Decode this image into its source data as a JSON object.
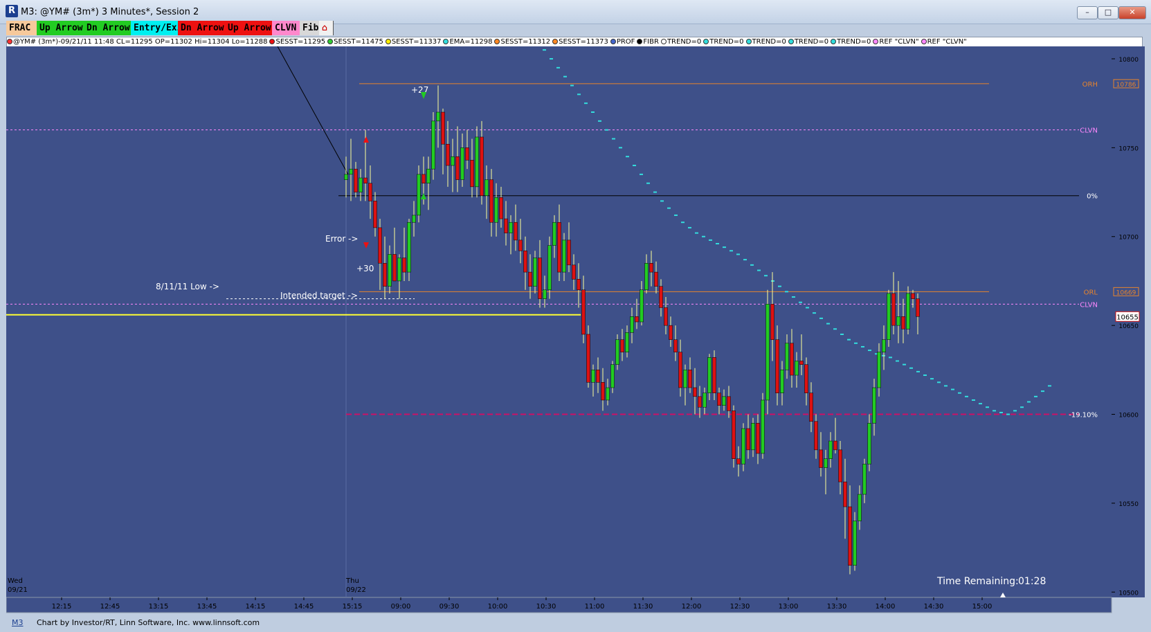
{
  "window": {
    "title": "M3: @YM# (3m*) 3 Minutes*, Session 2",
    "app_icon": "R",
    "controls": {
      "minimize": "–",
      "maximize": "□",
      "close": "✕"
    }
  },
  "toolbar": [
    {
      "label": "FRAC",
      "bg": "#f7c99b",
      "fg": "#000000"
    },
    {
      "label": "Up Arrow",
      "bg": "#22cc22",
      "fg": "#000000"
    },
    {
      "label": "Dn Arrow",
      "bg": "#22cc22",
      "fg": "#000000"
    },
    {
      "label": "Entry/Exit",
      "bg": "#00f0f0",
      "fg": "#000000"
    },
    {
      "label": "Dn Arrow",
      "bg": "#ee1111",
      "fg": "#000000"
    },
    {
      "label": "Up Arrow",
      "bg": "#ee1111",
      "fg": "#000000"
    },
    {
      "label": "CLVN",
      "bg": "#ff88cc",
      "fg": "#000000"
    },
    {
      "label": "Fib",
      "bg": "#d8d8d8",
      "fg": "#000000"
    }
  ],
  "toolbar_extra_icon": "house-icon",
  "legend": [
    {
      "color": "#ff3333",
      "text": "@YM# (3m*)-09/21/11 11:48 CL=11295 OP=11302 Hi=11304 Lo=11288"
    },
    {
      "color": "#ee1111",
      "text": "SESST=11295"
    },
    {
      "color": "#33cc33",
      "text": "SESST=11475"
    },
    {
      "color": "#ffee00",
      "text": "SESST=11337"
    },
    {
      "color": "#33dddd",
      "text": "EMA=11298"
    },
    {
      "color": "#ff8822",
      "text": "SESST=11312"
    },
    {
      "color": "#ff8822",
      "text": "SESST=11373"
    },
    {
      "color": "#4466cc",
      "text": "PROF"
    },
    {
      "color": "#000000",
      "text": "FIBR"
    },
    {
      "color": "#ffffff",
      "text": "TREND=0"
    },
    {
      "color": "#33dddd",
      "text": "TREND=0"
    },
    {
      "color": "#33dddd",
      "text": "TREND=0"
    },
    {
      "color": "#33dddd",
      "text": "TREND=0"
    },
    {
      "color": "#33dddd",
      "text": "TREND=0"
    },
    {
      "color": "#ff88ff",
      "text": "REF \"CLVN\""
    },
    {
      "color": "#ff88ff",
      "text": "REF \"CLVN\""
    }
  ],
  "colors": {
    "plot_bg": "#3e5089",
    "axis_bg": "#3e5089",
    "up_candle": "#22cc22",
    "down_candle": "#dd1111",
    "wick": "#ffff99",
    "ema": "#33dddd",
    "orange_line": "#e8842c",
    "clvn_line": "#ff88ff",
    "target_line": "#ffff33",
    "fib_line": "#cc1166",
    "zero_line": "#000000"
  },
  "chart_data": {
    "type": "candlestick",
    "symbol": "@YM# (3m*)",
    "ylim": [
      10497,
      10807
    ],
    "y_ticks": [
      10500,
      10550,
      10600,
      10650,
      10700,
      10750,
      10800
    ],
    "x_ticks": [
      "12:15",
      "12:45",
      "13:15",
      "13:45",
      "14:15",
      "14:45",
      "15:15",
      "09:00",
      "09:30",
      "10:00",
      "10:30",
      "11:00",
      "11:30",
      "12:00",
      "12:30",
      "13:00",
      "13:30",
      "14:00",
      "14:30",
      "15:00"
    ],
    "date_labels": [
      {
        "day": "Wed",
        "date": "09/21"
      },
      {
        "day": "Thu",
        "date": "09/22"
      }
    ],
    "horizontal_levels": [
      {
        "name": "ORH",
        "value": 10786,
        "badge": "10786",
        "color": "#e8842c"
      },
      {
        "name": "CLVN",
        "value": 10760,
        "badge": "",
        "color": "#ff88ff"
      },
      {
        "name": "0%",
        "value": 10723,
        "badge": "",
        "color": "#000000"
      },
      {
        "name": "ORL",
        "value": 10669,
        "badge": "10669",
        "color": "#e8842c"
      },
      {
        "name": "CLVN",
        "value": 10662,
        "badge": "",
        "color": "#ff88ff"
      },
      {
        "name": "-19.10%",
        "value": 10600,
        "badge": "",
        "color": "#cc1166"
      }
    ],
    "last_price": "10655",
    "annotations": [
      {
        "text": "+27",
        "color": "#ffffff"
      },
      {
        "text": "Error ->",
        "color": "#ffffff"
      },
      {
        "text": "+30",
        "color": "#ffffff"
      },
      {
        "text": "8/11/11 Low ->",
        "color": "#ffffff"
      },
      {
        "text": "Intended target ->",
        "color": "#ffffff"
      }
    ],
    "low_level_8_11": 10665,
    "intended_target": 10656,
    "time_remaining_label": "Time Remaining:",
    "time_remaining_value": "01:28",
    "candles": [
      [
        10732,
        10745,
        10722,
        10735
      ],
      [
        10735,
        10755,
        10720,
        10738
      ],
      [
        10738,
        10742,
        10722,
        10725
      ],
      [
        10725,
        10738,
        10720,
        10733
      ],
      [
        10733,
        10760,
        10720,
        10730
      ],
      [
        10730,
        10740,
        10710,
        10720
      ],
      [
        10720,
        10725,
        10700,
        10705
      ],
      [
        10705,
        10710,
        10670,
        10685
      ],
      [
        10685,
        10700,
        10665,
        10672
      ],
      [
        10672,
        10695,
        10668,
        10690
      ],
      [
        10690,
        10705,
        10680,
        10675
      ],
      [
        10675,
        10690,
        10665,
        10688
      ],
      [
        10688,
        10705,
        10675,
        10680
      ],
      [
        10680,
        10710,
        10675,
        10708
      ],
      [
        10708,
        10720,
        10700,
        10712
      ],
      [
        10712,
        10740,
        10708,
        10735
      ],
      [
        10735,
        10745,
        10718,
        10730
      ],
      [
        10730,
        10745,
        10715,
        10738
      ],
      [
        10738,
        10770,
        10732,
        10765
      ],
      [
        10765,
        10785,
        10750,
        10770
      ],
      [
        10770,
        10772,
        10735,
        10752
      ],
      [
        10752,
        10765,
        10728,
        10740
      ],
      [
        10740,
        10755,
        10725,
        10745
      ],
      [
        10745,
        10762,
        10725,
        10732
      ],
      [
        10732,
        10758,
        10728,
        10750
      ],
      [
        10750,
        10760,
        10738,
        10743
      ],
      [
        10743,
        10755,
        10722,
        10728
      ],
      [
        10728,
        10762,
        10722,
        10756
      ],
      [
        10756,
        10765,
        10718,
        10723
      ],
      [
        10723,
        10740,
        10710,
        10732
      ],
      [
        10732,
        10738,
        10700,
        10708
      ],
      [
        10708,
        10730,
        10700,
        10722
      ],
      [
        10722,
        10728,
        10705,
        10710
      ],
      [
        10710,
        10720,
        10695,
        10702
      ],
      [
        10702,
        10712,
        10690,
        10708
      ],
      [
        10708,
        10718,
        10692,
        10698
      ],
      [
        10698,
        10710,
        10685,
        10692
      ],
      [
        10692,
        10700,
        10670,
        10680
      ],
      [
        10680,
        10690,
        10665,
        10672
      ],
      [
        10672,
        10692,
        10668,
        10688
      ],
      [
        10688,
        10698,
        10660,
        10665
      ],
      [
        10665,
        10678,
        10660,
        10670
      ],
      [
        10670,
        10700,
        10665,
        10695
      ],
      [
        10695,
        10712,
        10688,
        10708
      ],
      [
        10708,
        10718,
        10675,
        10680
      ],
      [
        10680,
        10702,
        10675,
        10698
      ],
      [
        10698,
        10708,
        10680,
        10684
      ],
      [
        10684,
        10690,
        10670,
        10676
      ],
      [
        10676,
        10685,
        10660,
        10670
      ],
      [
        10670,
        10678,
        10640,
        10645
      ],
      [
        10645,
        10650,
        10615,
        10618
      ],
      [
        10618,
        10628,
        10610,
        10625
      ],
      [
        10625,
        10632,
        10612,
        10618
      ],
      [
        10618,
        10626,
        10602,
        10608
      ],
      [
        10608,
        10620,
        10605,
        10615
      ],
      [
        10615,
        10630,
        10612,
        10628
      ],
      [
        10628,
        10645,
        10625,
        10642
      ],
      [
        10642,
        10648,
        10630,
        10635
      ],
      [
        10635,
        10650,
        10632,
        10646
      ],
      [
        10646,
        10660,
        10640,
        10655
      ],
      [
        10655,
        10665,
        10648,
        10652
      ],
      [
        10652,
        10675,
        10650,
        10670
      ],
      [
        10670,
        10690,
        10668,
        10685
      ],
      [
        10685,
        10692,
        10672,
        10680
      ],
      [
        10680,
        10686,
        10668,
        10672
      ],
      [
        10672,
        10676,
        10655,
        10660
      ],
      [
        10660,
        10666,
        10645,
        10650
      ],
      [
        10650,
        10655,
        10638,
        10642
      ],
      [
        10642,
        10650,
        10630,
        10635
      ],
      [
        10635,
        10642,
        10610,
        10615
      ],
      [
        10615,
        10628,
        10605,
        10625
      ],
      [
        10625,
        10632,
        10612,
        10615
      ],
      [
        10615,
        10626,
        10600,
        10610
      ],
      [
        10610,
        10616,
        10598,
        10604
      ],
      [
        10604,
        10615,
        10600,
        10612
      ],
      [
        10612,
        10634,
        10608,
        10632
      ],
      [
        10632,
        10636,
        10608,
        10612
      ],
      [
        10612,
        10615,
        10600,
        10605
      ],
      [
        10605,
        10614,
        10602,
        10610
      ],
      [
        10610,
        10616,
        10598,
        10602
      ],
      [
        10602,
        10605,
        10570,
        10575
      ],
      [
        10575,
        10582,
        10565,
        10572
      ],
      [
        10572,
        10595,
        10568,
        10592
      ],
      [
        10592,
        10600,
        10575,
        10580
      ],
      [
        10580,
        10598,
        10576,
        10595
      ],
      [
        10595,
        10600,
        10572,
        10578
      ],
      [
        10578,
        10612,
        10575,
        10608
      ],
      [
        10608,
        10670,
        10600,
        10662
      ],
      [
        10662,
        10680,
        10630,
        10642
      ],
      [
        10642,
        10650,
        10605,
        10612
      ],
      [
        10612,
        10630,
        10605,
        10625
      ],
      [
        10625,
        10645,
        10620,
        10640
      ],
      [
        10640,
        10648,
        10615,
        10622
      ],
      [
        10622,
        10635,
        10615,
        10630
      ],
      [
        10630,
        10645,
        10622,
        10628
      ],
      [
        10628,
        10632,
        10605,
        10612
      ],
      [
        10612,
        10618,
        10590,
        10596
      ],
      [
        10596,
        10600,
        10575,
        10580
      ],
      [
        10580,
        10590,
        10565,
        10570
      ],
      [
        10570,
        10580,
        10555,
        10575
      ],
      [
        10575,
        10590,
        10570,
        10585
      ],
      [
        10585,
        10598,
        10578,
        10580
      ],
      [
        10580,
        10585,
        10555,
        10562
      ],
      [
        10562,
        10575,
        10530,
        10548
      ],
      [
        10548,
        10560,
        10510,
        10515
      ],
      [
        10515,
        10545,
        10512,
        10540
      ],
      [
        10540,
        10560,
        10535,
        10555
      ],
      [
        10555,
        10575,
        10550,
        10572
      ],
      [
        10572,
        10600,
        10568,
        10595
      ],
      [
        10595,
        10620,
        10588,
        10615
      ],
      [
        10615,
        10640,
        10610,
        10635
      ],
      [
        10635,
        10650,
        10625,
        10642
      ],
      [
        10642,
        10670,
        10638,
        10668
      ],
      [
        10668,
        10680,
        10645,
        10650
      ],
      [
        10650,
        10675,
        10640,
        10655
      ],
      [
        10655,
        10665,
        10640,
        10648
      ],
      [
        10648,
        10672,
        10645,
        10668
      ],
      [
        10668,
        10670,
        10660,
        10665
      ],
      [
        10665,
        10668,
        10645,
        10655
      ]
    ],
    "ema_values": [
      10809,
      10805,
      10800,
      10795,
      10790,
      10785,
      10780,
      10775,
      10770,
      10765,
      10760,
      10755,
      10750,
      10745,
      10740,
      10735,
      10730,
      10725,
      10720,
      10716,
      10712,
      10708,
      10705,
      10702,
      10700,
      10698,
      10696,
      10694,
      10692,
      10690,
      10687,
      10684,
      10681,
      10678,
      10675,
      10672,
      10669,
      10666,
      10663,
      10660,
      10657,
      10654,
      10651,
      10648,
      10645,
      10642,
      10640,
      10638,
      10636,
      10634,
      10633,
      10632,
      10630,
      10628,
      10626,
      10624,
      10622,
      10620,
      10618,
      10616,
      10614,
      10612,
      10610,
      10608,
      10606,
      10604,
      10602,
      10601,
      10600,
      10602,
      10604,
      10607,
      10610,
      10613,
      10616
    ]
  },
  "footer": {
    "tab": "M3",
    "credit": "Chart by Investor/RT, Linn Software, Inc. www.linnsoft.com"
  }
}
